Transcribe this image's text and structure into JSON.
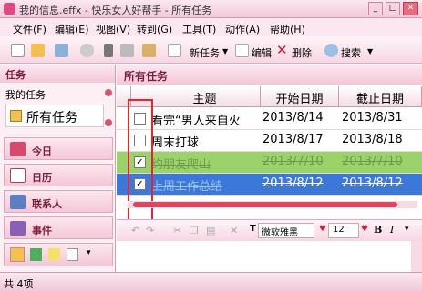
{
  "window": {
    "title": "我的信息.effx - 快乐女人好帮手 - 所有任务"
  },
  "menu": [
    "文件(F)",
    "编辑(E)",
    "视图(V)",
    "转到(G)",
    "工具(T)",
    "动作(A)",
    "帮助(H)"
  ],
  "toolbar": {
    "new_task": "新任务",
    "edit": "编辑",
    "delete": "删除",
    "search": "搜索"
  },
  "left_pane": {
    "header": "任务",
    "section": "我的任务",
    "selected_item": "所有任务",
    "nav": [
      "今日",
      "日历",
      "联系人",
      "事件"
    ]
  },
  "main": {
    "title": "所有任务",
    "columns": [
      "主题",
      "开始日期",
      "截止日期"
    ],
    "rows": [
      {
        "subject": "看完“男人来自火",
        "start": "2013/8/14",
        "due": "2013/8/31",
        "checked": false,
        "mark": "",
        "style": "normal"
      },
      {
        "subject": "周末打球",
        "start": "2013/8/17",
        "due": "2013/8/18",
        "checked": false,
        "mark": "",
        "style": "normal"
      },
      {
        "subject": "约朋友爬山",
        "start": "2013/7/10",
        "due": "2013/7/10",
        "checked": true,
        "mark": "✓",
        "style": "done-green"
      },
      {
        "subject": "上周工作总结",
        "start": "2013/8/12",
        "due": "2013/8/12",
        "checked": true,
        "mark": "✓",
        "style": "done-selected"
      }
    ]
  },
  "editor": {
    "font": "微软雅黑",
    "size": "12",
    "bold": "B",
    "italic": "I"
  },
  "status": {
    "count": "共 4项"
  },
  "colors": {
    "accent": "#e04b86",
    "green_row": "#9bd36a",
    "selected_row": "#3b78d8",
    "highlight_box": "#e0262f"
  }
}
